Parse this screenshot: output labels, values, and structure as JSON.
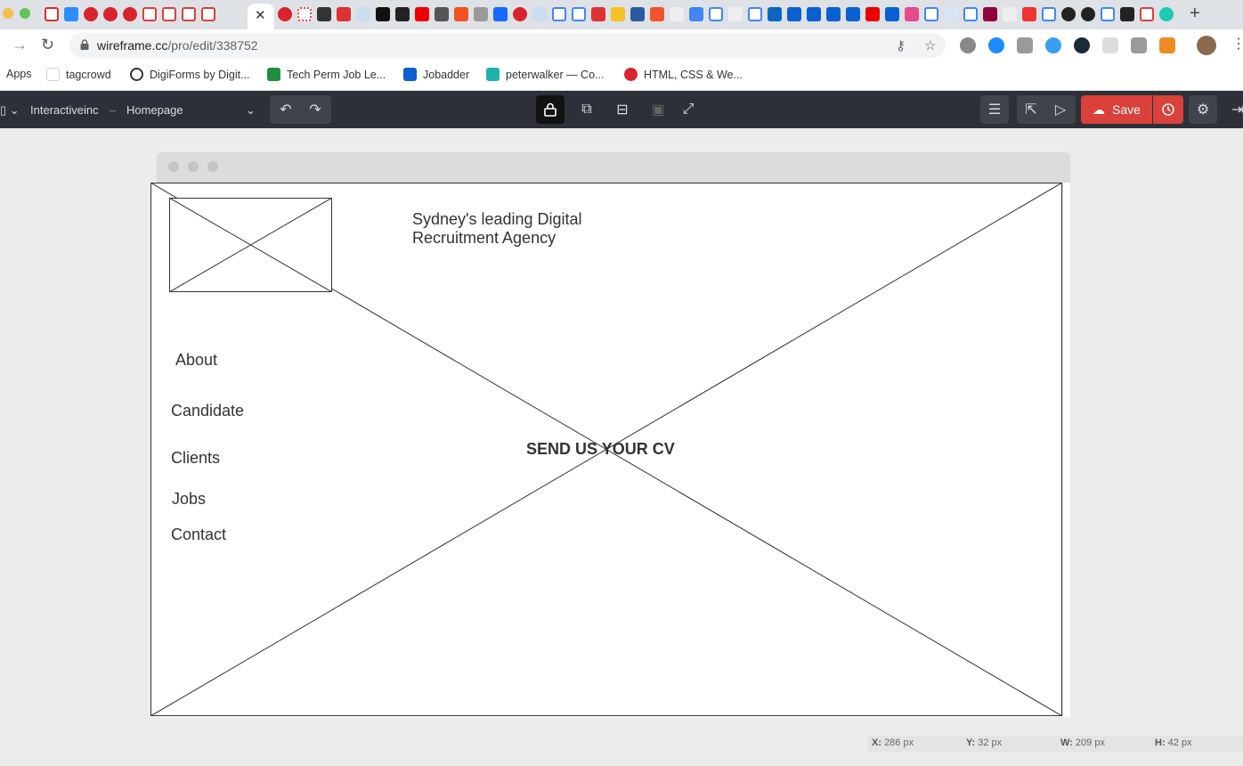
{
  "browser": {
    "url_host": "wireframe.cc",
    "url_path": "/pro/edit/338752",
    "bookmarks": [
      {
        "label": "Apps",
        "icon": "apps-grid-icon"
      },
      {
        "label": "tagcrowd",
        "icon": "tagcrowd-icon"
      },
      {
        "label": "DigiForms by Digit...",
        "icon": "digiforms-icon"
      },
      {
        "label": "Tech Perm Job Le...",
        "icon": "sheets-icon"
      },
      {
        "label": "Jobadder",
        "icon": "jobadder-icon"
      },
      {
        "label": "peterwalker — Co...",
        "icon": "codepen-icon"
      },
      {
        "label": "HTML, CSS & We...",
        "icon": "ga-icon"
      }
    ]
  },
  "app": {
    "project": "Interactiveinc",
    "separator": "–",
    "page": "Homepage",
    "save_label": "Save"
  },
  "wireframe": {
    "headline": "Sydney's leading Digital Recruitment Agency",
    "nav": [
      "About",
      "Candidate",
      "Clients",
      "Jobs",
      "Contact"
    ],
    "cta": "SEND US YOUR CV"
  },
  "status": {
    "x_label": "X:",
    "x_value": "286 px",
    "y_label": "Y:",
    "y_value": "32 px",
    "w_label": "W:",
    "w_value": "209 px",
    "h_label": "H:",
    "h_value": "42 px"
  },
  "colors": {
    "toolbar_bg": "#2d3038",
    "save_red": "#d9413a",
    "canvas_bg": "#ececec"
  }
}
